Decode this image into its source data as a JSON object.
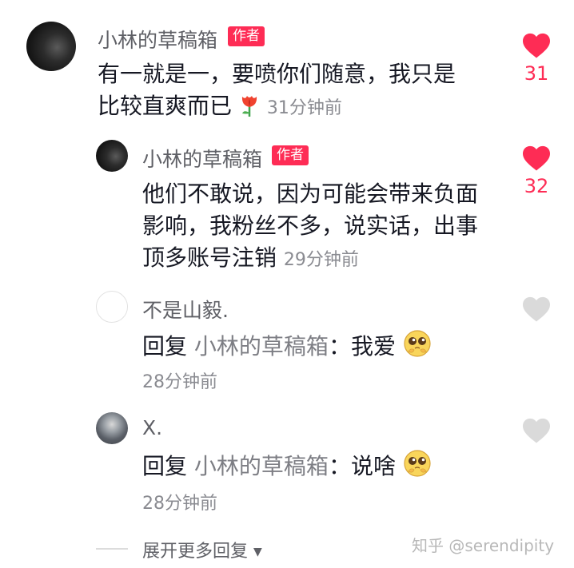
{
  "comments": [
    {
      "username": "小林的草稿箱",
      "badge": "作者",
      "line1": "有一就是一，要喷你们随意，我只是",
      "line2": "比较直爽而已",
      "time": "31分钟前",
      "likes": "31",
      "liked": true
    },
    {
      "username": "小林的草稿箱",
      "badge": "作者",
      "line1": "他们不敢说，因为可能会带来负面",
      "line2": "影响，我粉丝不多，说实话，出事",
      "line3": "顶多账号注销",
      "time": "29分钟前",
      "likes": "32",
      "liked": true
    },
    {
      "username": "不是山毅.",
      "reply_prefix": "回复",
      "reply_target": "小林的草稿箱",
      "reply_text": "：我爱",
      "time": "28分钟前",
      "liked": false
    },
    {
      "username": "X.",
      "reply_prefix": "回复",
      "reply_target": "小林的草稿箱",
      "reply_text": "：说啥",
      "time": "28分钟前",
      "liked": false
    }
  ],
  "expand_more": "展开更多回复",
  "watermark": "知乎 @serendipity",
  "colors": {
    "accent": "#fe2c55",
    "muted": "#8a8b91"
  },
  "icons": {
    "like": "heart-icon",
    "expand": "triangle-down-icon",
    "flower": "tulip-emoji",
    "face": "pleading-face-emoji"
  }
}
